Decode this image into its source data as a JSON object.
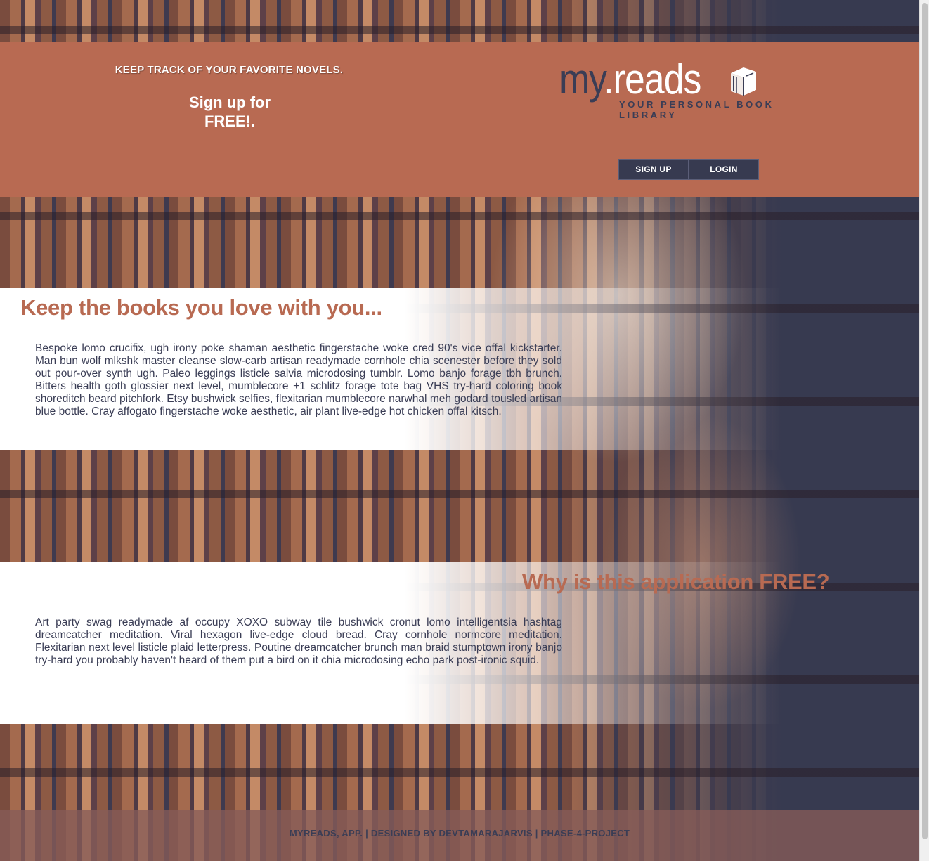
{
  "header": {
    "tagline": "KEEP TRACK OF YOUR FAVORITE NOVELS.",
    "cta_line1": "Sign up for",
    "cta_line2": "FREE!.",
    "logo": {
      "my": "my",
      "reads": ".reads",
      "subtitle": "YOUR PERSONAL BOOK LIBRARY",
      "icon": "book-icon"
    },
    "signup_label": "SIGN UP",
    "login_label": "LOGIN"
  },
  "sections": [
    {
      "heading": "Keep the books you love with you...",
      "body": "Bespoke lomo crucifix, ugh irony poke shaman aesthetic fingerstache woke cred 90's vice offal kickstarter. Man bun wolf mlkshk master cleanse slow-carb artisan readymade cornhole chia scenester before they sold out pour-over synth ugh. Paleo leggings listicle salvia microdosing tumblr. Lomo banjo forage tbh brunch. Bitters health goth glossier next level, mumblecore +1 schlitz forage tote bag VHS try-hard coloring book shoreditch beard pitchfork. Etsy bushwick selfies, flexitarian mumblecore narwhal meh godard tousled artisan blue bottle. Cray affogato fingerstache woke aesthetic, air plant live-edge hot chicken offal kitsch."
    },
    {
      "heading": "Why is this application FREE?",
      "body": "Art party swag readymade af occupy XOXO subway tile bushwick cronut lomo intelligentsia hashtag dreamcatcher meditation. Viral hexagon live-edge cloud bread. Cray cornhole normcore meditation. Flexitarian next level listicle plaid letterpress. Poutine dreamcatcher brunch man braid stumptown irony banjo try-hard you probably haven't heard of them put a bird on it chia microdosing echo park post-ironic squid."
    }
  ],
  "footer": {
    "credits": "MYREADS, APP. | DESIGNED BY DEVTAMARAJARVIS | PHASE-4-PROJECT"
  },
  "colors": {
    "accent": "#b86a52",
    "navy": "#373a50",
    "white": "#ffffff"
  }
}
